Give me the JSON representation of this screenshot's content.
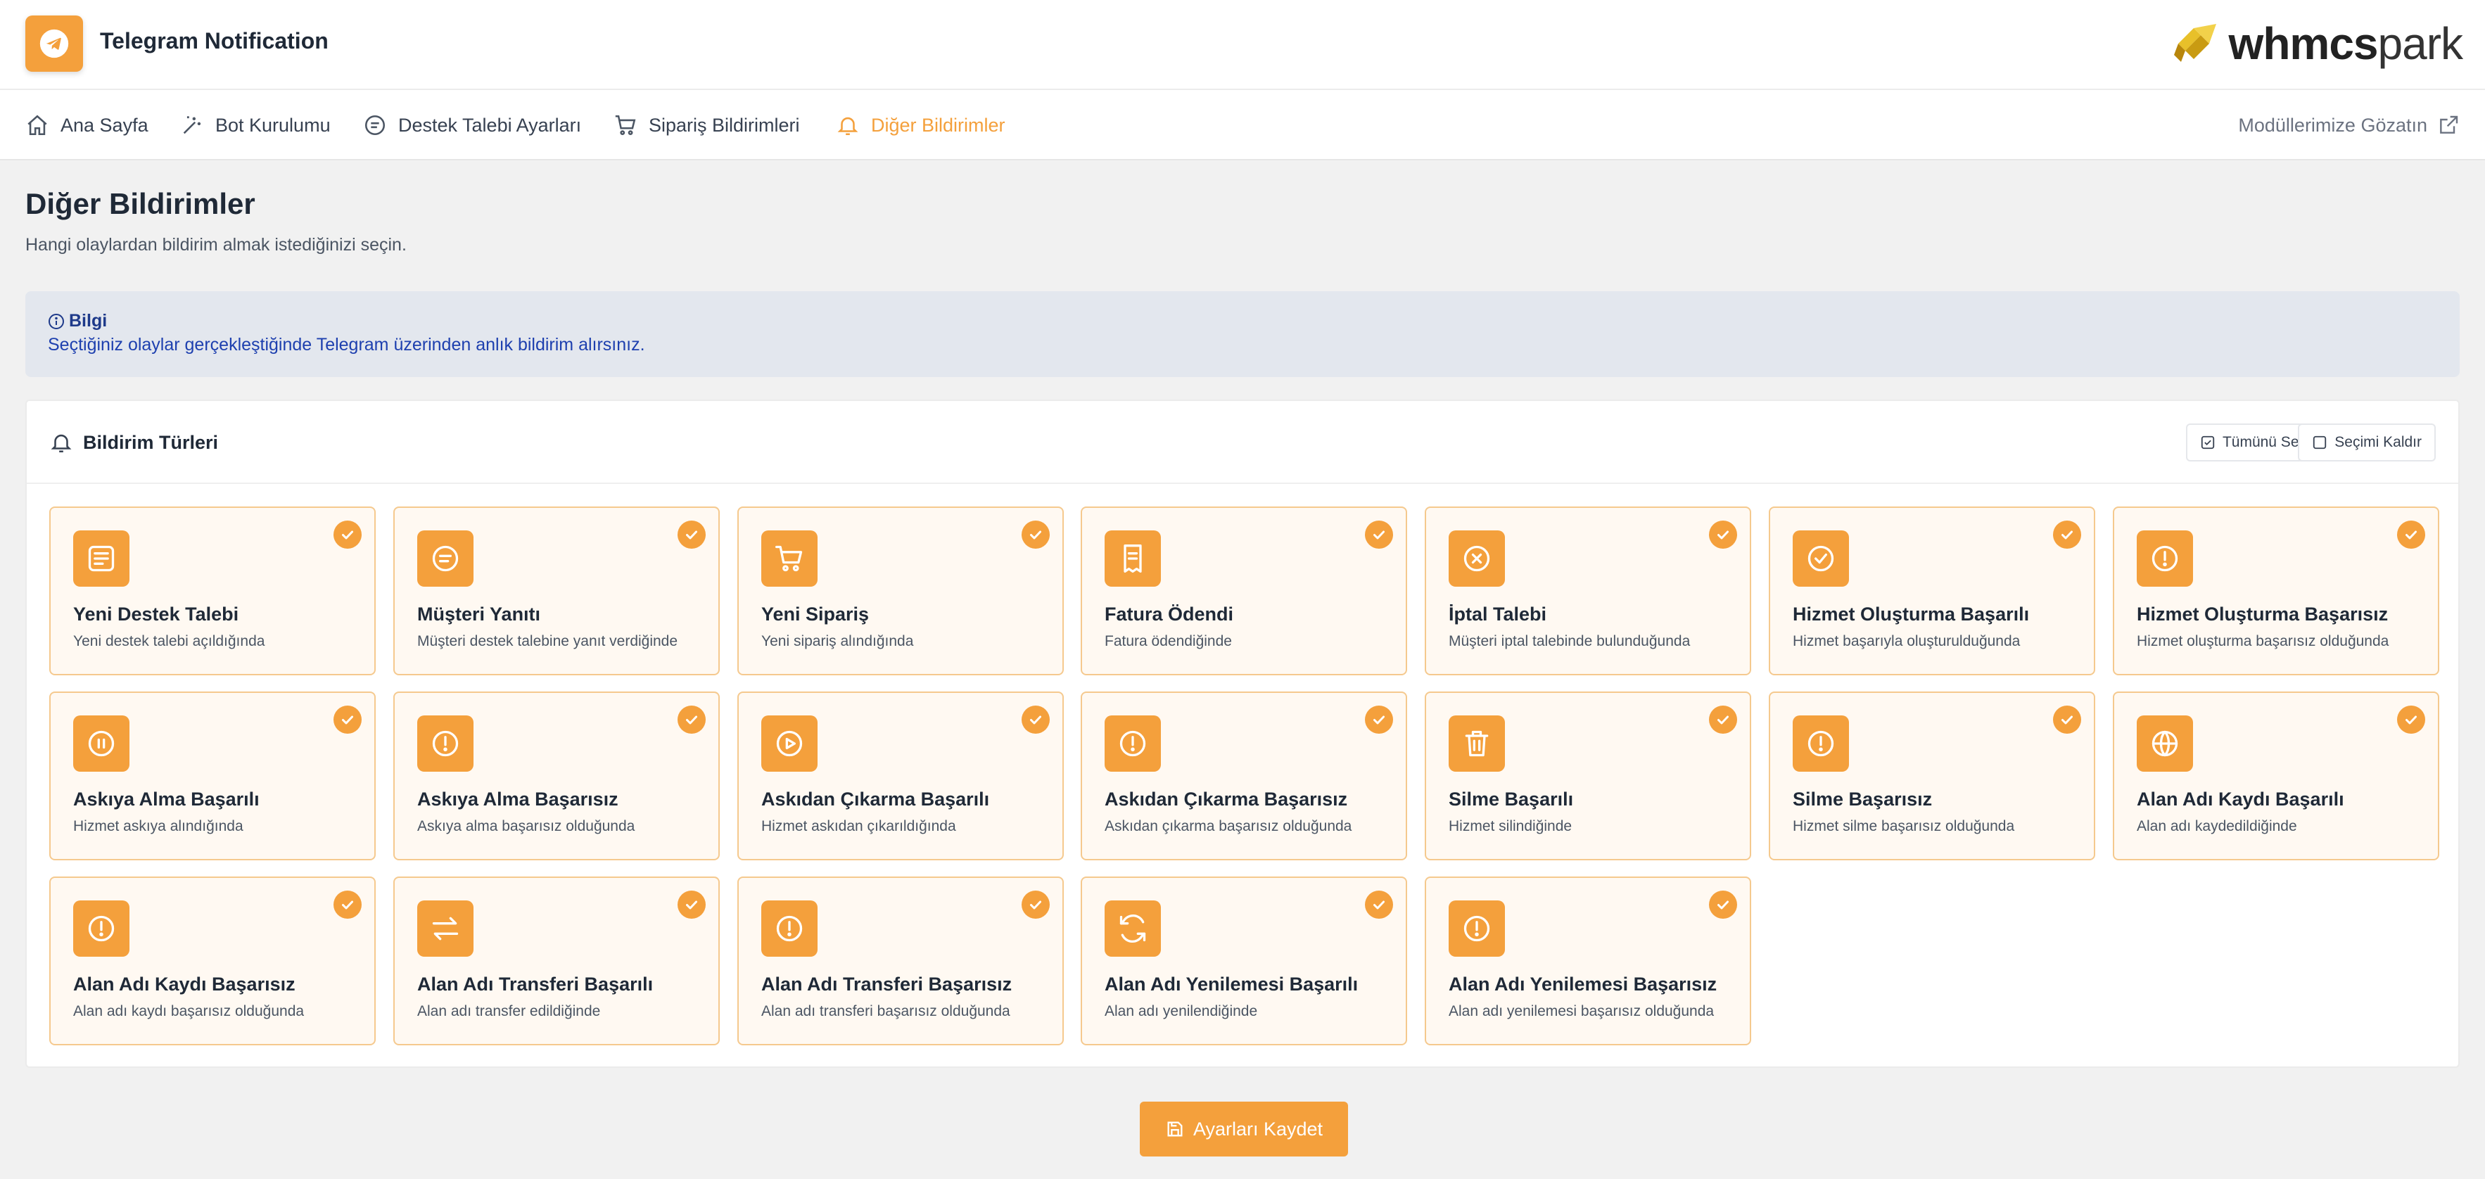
{
  "header": {
    "app_title": "Telegram Notification",
    "logo_text_bold": "whmcs",
    "logo_text_light": "park"
  },
  "nav": {
    "items": [
      {
        "label": "Ana Sayfa",
        "icon": "home-icon"
      },
      {
        "label": "Bot Kurulumu",
        "icon": "wand-icon"
      },
      {
        "label": "Destek Talebi Ayarları",
        "icon": "ticket-icon"
      },
      {
        "label": "Sipariş Bildirimleri",
        "icon": "cart-icon"
      },
      {
        "label": "Diğer Bildirimler",
        "icon": "bell-icon",
        "active": true
      }
    ],
    "right_link": "Modüllerimize Gözatın"
  },
  "page": {
    "title": "Diğer Bildirimler",
    "subtitle": "Hangi olaylardan bildirim almak istediğinizi seçin."
  },
  "info": {
    "title": "Bilgi",
    "text": "Seçtiğiniz olaylar gerçekleştiğinde Telegram üzerinden anlık bildirim alırsınız."
  },
  "panel": {
    "title": "Bildirim Türleri",
    "select_all": "Tümünü Seç",
    "clear_selection": "Seçimi Kaldır"
  },
  "cards": [
    {
      "title": "Yeni Destek Talebi",
      "desc": "Yeni destek talebi açıldığında",
      "icon": "message-icon",
      "checked": true
    },
    {
      "title": "Müşteri Yanıtı",
      "desc": "Müşteri destek talebine yanıt verdiğinde",
      "icon": "reply-icon",
      "checked": true
    },
    {
      "title": "Yeni Sipariş",
      "desc": "Yeni sipariş alındığında",
      "icon": "cart-icon",
      "checked": true
    },
    {
      "title": "Fatura Ödendi",
      "desc": "Fatura ödendiğinde",
      "icon": "invoice-icon",
      "checked": true
    },
    {
      "title": "İptal Talebi",
      "desc": "Müşteri iptal talebinde bulunduğunda",
      "icon": "x-circle-icon",
      "checked": true
    },
    {
      "title": "Hizmet Oluşturma Başarılı",
      "desc": "Hizmet başarıyla oluşturulduğunda",
      "icon": "check-circle-icon",
      "checked": true
    },
    {
      "title": "Hizmet Oluşturma Başarısız",
      "desc": "Hizmet oluşturma başarısız olduğunda",
      "icon": "alert-circle-icon",
      "checked": true
    },
    {
      "title": "Askıya Alma Başarılı",
      "desc": "Hizmet askıya alındığında",
      "icon": "pause-circle-icon",
      "checked": true
    },
    {
      "title": "Askıya Alma Başarısız",
      "desc": "Askıya alma başarısız olduğunda",
      "icon": "alert-circle-icon",
      "checked": true
    },
    {
      "title": "Askıdan Çıkarma Başarılı",
      "desc": "Hizmet askıdan çıkarıldığında",
      "icon": "play-circle-icon",
      "checked": true
    },
    {
      "title": "Askıdan Çıkarma Başarısız",
      "desc": "Askıdan çıkarma başarısız olduğunda",
      "icon": "alert-circle-icon",
      "checked": true
    },
    {
      "title": "Silme Başarılı",
      "desc": "Hizmet silindiğinde",
      "icon": "trash-icon",
      "checked": true
    },
    {
      "title": "Silme Başarısız",
      "desc": "Hizmet silme başarısız olduğunda",
      "icon": "alert-circle-icon",
      "checked": true
    },
    {
      "title": "Alan Adı Kaydı Başarılı",
      "desc": "Alan adı kaydedildiğinde",
      "icon": "globe-icon",
      "checked": true
    },
    {
      "title": "Alan Adı Kaydı Başarısız",
      "desc": "Alan adı kaydı başarısız olduğunda",
      "icon": "alert-circle-icon",
      "checked": true
    },
    {
      "title": "Alan Adı Transferi Başarılı",
      "desc": "Alan adı transfer edildiğinde",
      "icon": "transfer-icon",
      "checked": true
    },
    {
      "title": "Alan Adı Transferi Başarısız",
      "desc": "Alan adı transferi başarısız olduğunda",
      "icon": "alert-circle-icon",
      "checked": true
    },
    {
      "title": "Alan Adı Yenilemesi Başarılı",
      "desc": "Alan adı yenilendiğinde",
      "icon": "refresh-icon",
      "checked": true
    },
    {
      "title": "Alan Adı Yenilemesi Başarısız",
      "desc": "Alan adı yenilemesi başarısız olduğunda",
      "icon": "alert-circle-icon",
      "checked": true
    }
  ],
  "save_button": "Ayarları Kaydet",
  "colors": {
    "accent": "#f4a03c",
    "card_bg": "#fff9f2",
    "card_border": "#f5c98e",
    "info_bg": "#e3e7ee",
    "info_text": "#1e40af"
  }
}
